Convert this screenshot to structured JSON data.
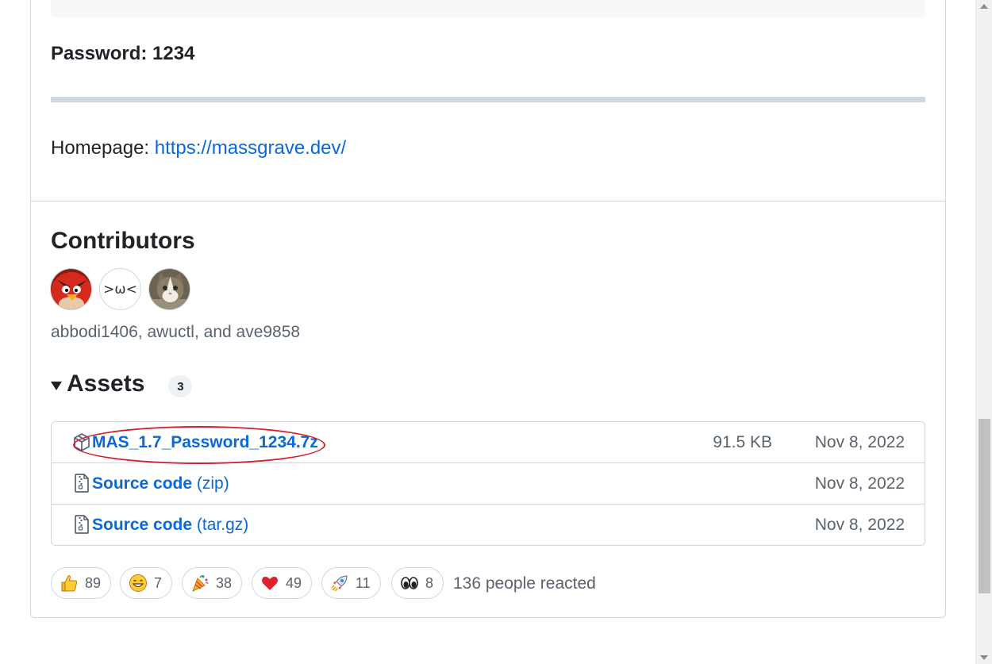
{
  "release": {
    "password_text": "Password: 1234",
    "homepage_label": "Homepage: ",
    "homepage_url": "https://massgrave.dev/"
  },
  "contributors": {
    "title": "Contributors",
    "avatars": [
      {
        "name": "abbodi1406",
        "icon": "angry-bird-avatar"
      },
      {
        "name": "awuctl",
        "icon": "kaomoji-avatar",
        "glyph": ">ω<"
      },
      {
        "name": "ave9858",
        "icon": "cat-avatar"
      }
    ],
    "names_text": "abbodi1406, awuctl, and ave9858"
  },
  "assets": {
    "title": "Assets",
    "count": "3",
    "items": [
      {
        "name": "MAS_1.7_Password_1234.7z",
        "suffix": "",
        "size": "91.5 KB",
        "date": "Nov 8, 2022",
        "icon": "package-icon"
      },
      {
        "name": "Source code",
        "suffix": "(zip)",
        "size": "",
        "date": "Nov 8, 2022",
        "icon": "file-zip-icon"
      },
      {
        "name": "Source code",
        "suffix": "(tar.gz)",
        "size": "",
        "date": "Nov 8, 2022",
        "icon": "file-zip-icon"
      }
    ]
  },
  "reactions": {
    "items": [
      {
        "emoji": "thumbs-up",
        "count": "89"
      },
      {
        "emoji": "laugh",
        "count": "7"
      },
      {
        "emoji": "hooray",
        "count": "38"
      },
      {
        "emoji": "heart",
        "count": "49"
      },
      {
        "emoji": "rocket",
        "count": "11"
      },
      {
        "emoji": "eyes",
        "count": "8"
      }
    ],
    "summary": "136 people reacted"
  },
  "colors": {
    "link": "#0969da",
    "muted": "#59636e",
    "border": "#d0d7de",
    "highlight": "#d0202a"
  }
}
